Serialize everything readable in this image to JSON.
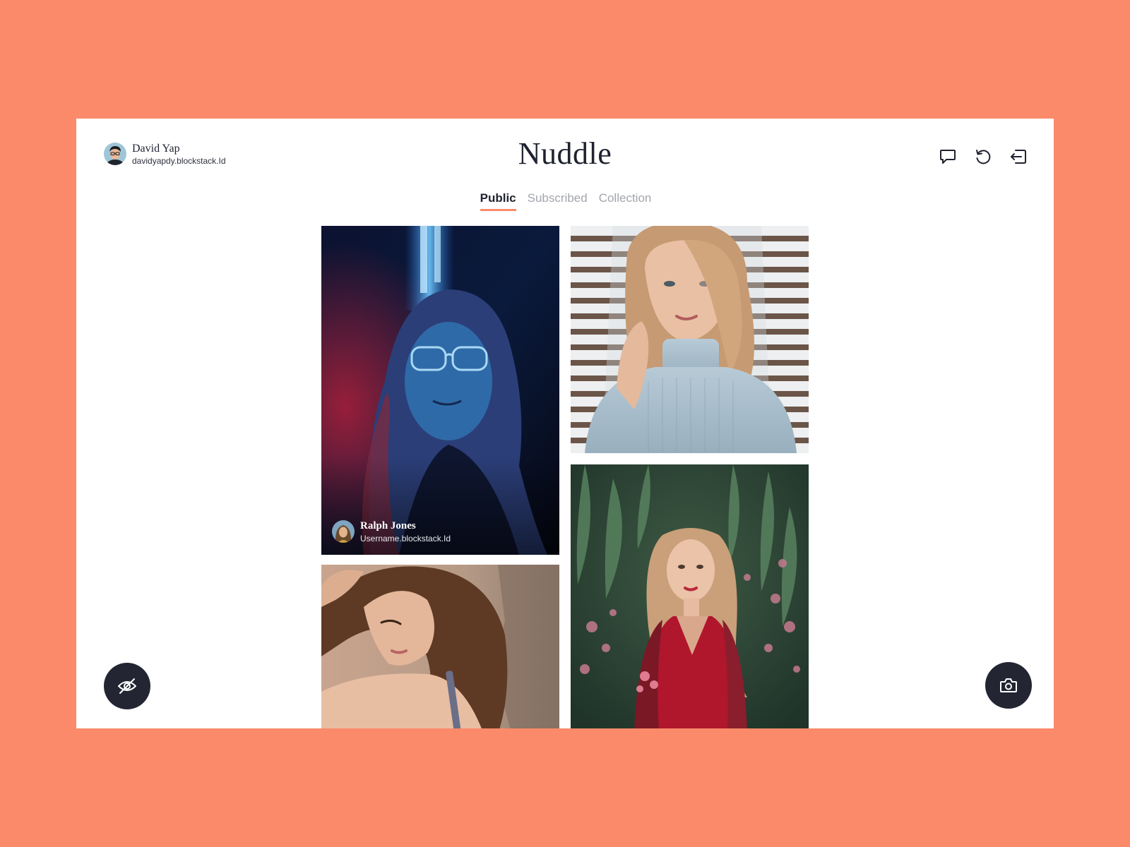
{
  "app": {
    "brand": "Nuddle",
    "background_color": "#FA8A69",
    "accent_color": "#FA8A69",
    "dark_color": "#232533"
  },
  "user": {
    "name": "David Yap",
    "handle": "davidyapdy.blockstack.Id",
    "avatar_icon": "user-avatar"
  },
  "header_actions": [
    {
      "icon": "chat-bubble-icon",
      "label": "Messages"
    },
    {
      "icon": "refresh-icon",
      "label": "Refresh"
    },
    {
      "icon": "logout-icon",
      "label": "Log out"
    }
  ],
  "tabs": [
    {
      "label": "Public",
      "active": true
    },
    {
      "label": "Subscribed",
      "active": false
    },
    {
      "label": "Collection",
      "active": false
    }
  ],
  "feed": {
    "photos": [
      {
        "subject": "portrait-neon-glasses",
        "author_name": "Ralph Jones",
        "author_handle": "Username.blockstack.Id"
      },
      {
        "subject": "portrait-turtleneck-blinds"
      },
      {
        "subject": "portrait-hand-in-hair"
      },
      {
        "subject": "portrait-red-dress-flowers"
      }
    ]
  },
  "fabs": {
    "left_icon": "eye-off-icon",
    "right_icon": "camera-icon"
  }
}
